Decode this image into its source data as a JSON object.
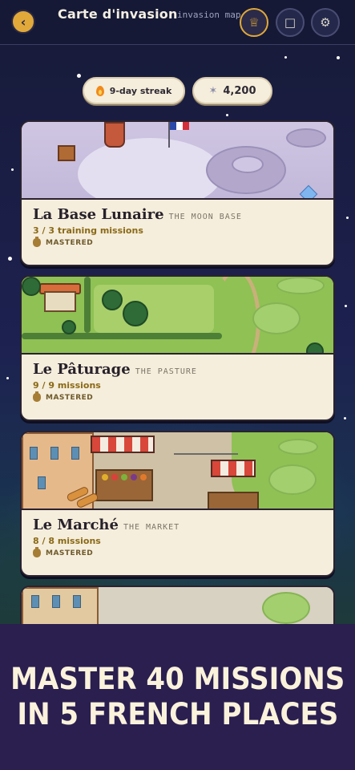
{
  "header": {
    "title": "Carte d'invasion",
    "subtitle": "invasion map",
    "back_icon": "back-arrow-icon",
    "buttons": [
      {
        "icon": "crown-icon",
        "active": true
      },
      {
        "icon": "book-icon",
        "active": false
      },
      {
        "icon": "gear-icon",
        "active": false
      }
    ]
  },
  "stats": {
    "streak_label": "9-day streak",
    "points": "4,200"
  },
  "places": [
    {
      "name": "La Base Lunaire",
      "english": "THE MOON BASE",
      "progress": "3 / 3 training missions",
      "status": "MASTERED"
    },
    {
      "name": "Le Pâturage",
      "english": "THE PASTURE",
      "progress": "9 / 9 missions",
      "status": "MASTERED"
    },
    {
      "name": "Le Marché",
      "english": "THE MARKET",
      "progress": "8 / 8 missions",
      "status": "MASTERED"
    }
  ],
  "banner": {
    "line1": "MASTER 40 MISSIONS",
    "line2": "IN 5 FRENCH PLACES"
  },
  "colors": {
    "accent": "#e0a93a",
    "card_bg": "#f6eedc",
    "banner_bg": "#2a1f4f",
    "progress_text": "#8a6a18"
  }
}
